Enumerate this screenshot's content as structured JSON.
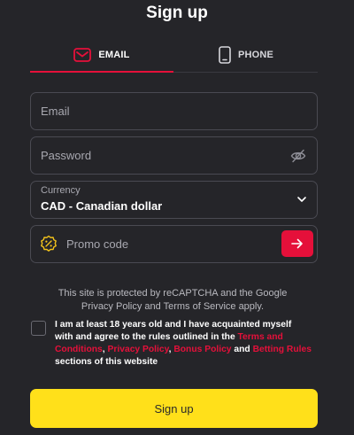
{
  "title": "Sign up",
  "tabs": {
    "email": {
      "label": "EMAIL",
      "icon": "envelope-icon",
      "active": true
    },
    "phone": {
      "label": "PHONE",
      "icon": "smartphone-icon",
      "active": false
    }
  },
  "form": {
    "email": {
      "placeholder": "Email",
      "value": ""
    },
    "password": {
      "placeholder": "Password",
      "value": "",
      "icon": "eye-off-icon"
    },
    "currency": {
      "label": "Currency",
      "value": "CAD - Canadian dollar",
      "icon": "chevron-down-icon"
    },
    "promo": {
      "placeholder": "Promo code",
      "value": "",
      "icon": "percent-badge-icon",
      "submit_icon": "arrow-right-icon"
    }
  },
  "recaptcha_notice": "This site is protected by reCAPTCHA and the Google Privacy Policy and Terms of Service apply.",
  "agreement": {
    "checked": false,
    "text_1": "I am at least 18 years old and I have acquainted myself with and agree to the rules outlined in the ",
    "link_terms": "Terms and Conditions",
    "sep_1": ", ",
    "link_privacy": "Privacy Policy",
    "sep_2": ", ",
    "link_bonus": "Bonus Policy",
    "sep_3": " and ",
    "link_betting": "Betting Rules",
    "text_2": " sections of this website"
  },
  "submit_label": "Sign up",
  "colors": {
    "background": "#252529",
    "accent": "#e5103a",
    "primary_button": "#ffe01a",
    "input_border": "#4a4a52"
  }
}
